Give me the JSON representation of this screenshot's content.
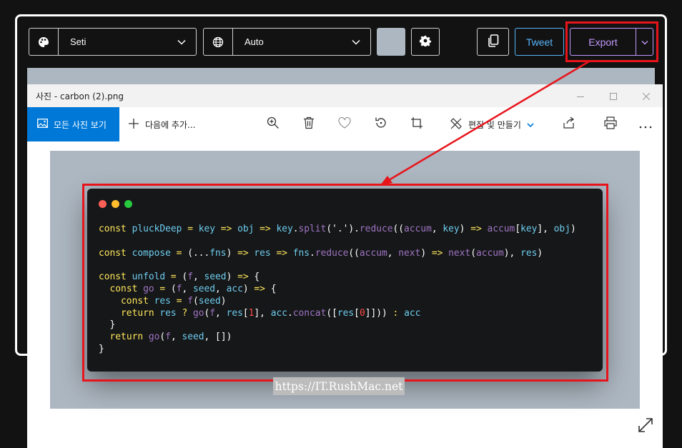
{
  "carbon": {
    "theme_label": "Seti",
    "language_label": "Auto",
    "background_swatch_color": "#adb7c1",
    "tweet_label": "Tweet",
    "export_label": "Export"
  },
  "photos": {
    "window_title": "사진 - carbon (2).png",
    "all_photos_label": "모든 사진 보기",
    "add_to_label": "다음에 추가...",
    "edit_create_label": "편집 및 만들기"
  },
  "code_lines": [
    "const pluckDeep = key => obj => key.split('.').reduce((accum, key) => accum[key], obj)",
    "",
    "const compose = (...fns) => res => fns.reduce((accum, next) => next(accum), res)",
    "",
    "const unfold = (f, seed) => {",
    "  const go = (f, seed, acc) => {",
    "    const res = f(seed)",
    "    return res ? go(f, res[1], acc.concat([res[0]])) : acc",
    "  }",
    "  return go(f, seed, [])",
    "}"
  ],
  "watermark": "https://IT.RushMac.net",
  "colors": {
    "accent_red": "#e8141b",
    "photos_blue": "#0078d7",
    "tweet_blue": "#57b5f9",
    "export_purple": "#c198fb",
    "keyword_yellow": "#ffe55c",
    "identifier_cyan": "#6fcdf0",
    "function_purple": "#a074c4",
    "number_red": "#ff4b4b"
  },
  "icons": {
    "theme": "palette-icon",
    "language": "globe-icon",
    "settings": "gear-icon",
    "copy": "copy-icon",
    "zoom": "zoom-in-icon",
    "delete": "trash-icon",
    "favorite": "heart-icon",
    "rotate": "rotate-icon",
    "crop": "crop-icon",
    "edit": "edit-tools-icon",
    "share": "share-icon",
    "print": "print-icon",
    "more": "more-icon",
    "expand": "expand-icon"
  }
}
